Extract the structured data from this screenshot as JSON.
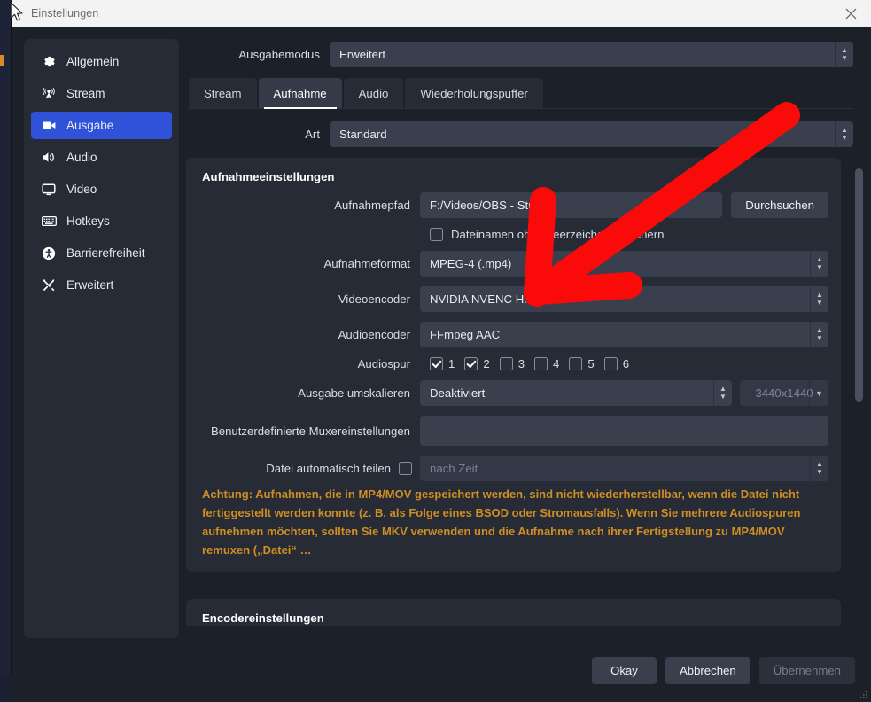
{
  "window": {
    "title": "Einstellungen",
    "close_label": "✕"
  },
  "sidebar": {
    "items": [
      {
        "label": "Allgemein",
        "icon": "gear-icon",
        "active": false
      },
      {
        "label": "Stream",
        "icon": "broadcast-icon",
        "active": false
      },
      {
        "label": "Ausgabe",
        "icon": "output-video-icon",
        "active": true
      },
      {
        "label": "Audio",
        "icon": "speaker-icon",
        "active": false
      },
      {
        "label": "Video",
        "icon": "monitor-icon",
        "active": false
      },
      {
        "label": "Hotkeys",
        "icon": "keyboard-icon",
        "active": false
      },
      {
        "label": "Barrierefreiheit",
        "icon": "accessibility-icon",
        "active": false
      },
      {
        "label": "Erweitert",
        "icon": "tools-icon",
        "active": false
      }
    ]
  },
  "output_mode": {
    "label": "Ausgabemodus",
    "value": "Erweitert"
  },
  "tabs": [
    {
      "label": "Stream",
      "active": false
    },
    {
      "label": "Aufnahme",
      "active": true
    },
    {
      "label": "Audio",
      "active": false
    },
    {
      "label": "Wiederholungspuffer",
      "active": false
    }
  ],
  "type_row": {
    "label": "Art",
    "value": "Standard"
  },
  "recording_group": {
    "title": "Aufnahmeeinstellungen",
    "path": {
      "label": "Aufnahmepfad",
      "value": "F:/Videos/OBS - Studio",
      "browse_label": "Durchsuchen"
    },
    "no_spaces": {
      "label": "Dateinamen ohne Leerzeichen speichern",
      "checked": false
    },
    "format": {
      "label": "Aufnahmeformat",
      "value": "MPEG-4 (.mp4)"
    },
    "video_encoder": {
      "label": "Videoencoder",
      "value": "NVIDIA NVENC H.264"
    },
    "audio_encoder": {
      "label": "Audioencoder",
      "value": "FFmpeg AAC"
    },
    "audio_tracks": {
      "label": "Audiospur",
      "tracks": [
        {
          "num": "1",
          "checked": true
        },
        {
          "num": "2",
          "checked": true
        },
        {
          "num": "3",
          "checked": false
        },
        {
          "num": "4",
          "checked": false
        },
        {
          "num": "5",
          "checked": false
        },
        {
          "num": "6",
          "checked": false
        }
      ]
    },
    "rescale": {
      "label": "Ausgabe umskalieren",
      "value": "Deaktiviert",
      "resolution": "3440x1440"
    },
    "muxer": {
      "label": "Benutzerdefinierte Muxereinstellungen",
      "value": ""
    },
    "auto_split": {
      "label": "Datei automatisch teilen",
      "checked": false,
      "value_placeholder": "nach Zeit"
    },
    "warning": "Achtung: Aufnahmen, die in MP4/MOV gespeichert werden, sind nicht wiederherstellbar, wenn die Datei nicht fertiggestellt werden konnte (z. B. als Folge eines BSOD oder Stromausfalls). Wenn Sie mehrere Audiospuren aufnehmen möchten, sollten Sie MKV verwenden und die Aufnahme nach ihrer Fertigstellung zu MP4/MOV remuxen („Datei“ …"
  },
  "encoder_group": {
    "title": "Encodereinstellungen"
  },
  "dialog_buttons": {
    "ok": "Okay",
    "cancel": "Abbrechen",
    "apply": "Übernehmen"
  },
  "annotation": {
    "arrow_color": "#fb0a0a"
  },
  "colors": {
    "accent": "#2f52d8",
    "warning": "#cf8e23",
    "panel": "#262b36",
    "field": "#3a3f4d",
    "window": "#1c2028"
  }
}
